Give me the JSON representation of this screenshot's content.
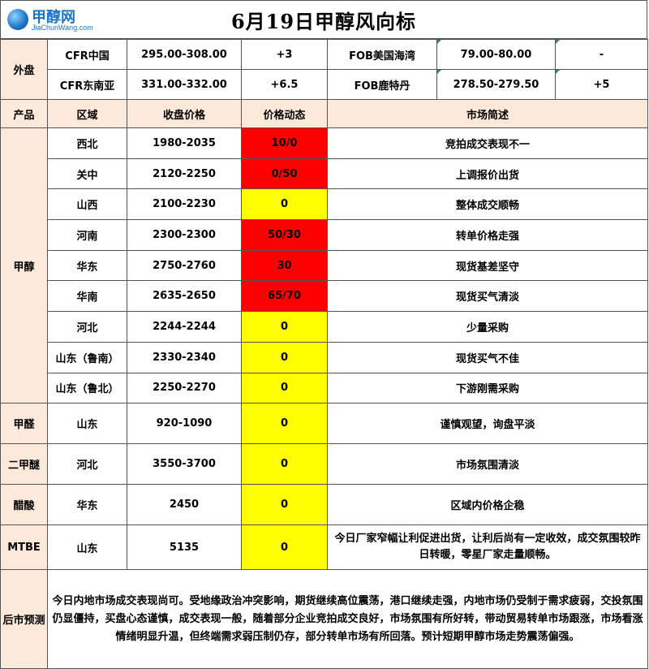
{
  "header": {
    "title": "6月19日甲醇风向标",
    "logo_name": "甲醇网",
    "logo_url": "JiaChunWang.com"
  },
  "external": {
    "label": "外盘",
    "rows": [
      {
        "market_a": "CFR中国",
        "price_a": "295.00-308.00",
        "change_a": "+3",
        "market_b": "FOB美国海湾",
        "price_b": "79.00-80.00",
        "change_b": "-"
      },
      {
        "market_a": "CFR东南亚",
        "price_a": "331.00-332.00",
        "change_a": "+6.5",
        "market_b": "FOB鹿特丹",
        "price_b": "278.50-279.50",
        "change_b": "+5"
      }
    ]
  },
  "columns": {
    "product": "产品",
    "region": "区域",
    "close_price": "收盘价格",
    "price_move": "价格动态",
    "market_brief": "市场简述"
  },
  "products": [
    {
      "name": "甲醇",
      "rows": [
        {
          "region": "西北",
          "price": "1980-2035",
          "move": "10/0",
          "color": "red",
          "note": "竞拍成交表现不一"
        },
        {
          "region": "关中",
          "price": "2120-2250",
          "move": "0/50",
          "color": "red",
          "note": "上调报价出货"
        },
        {
          "region": "山西",
          "price": "2100-2230",
          "move": "0",
          "color": "yellow",
          "note": "整体成交顺畅"
        },
        {
          "region": "河南",
          "price": "2300-2300",
          "move": "50/30",
          "color": "red",
          "note": "转单价格走强"
        },
        {
          "region": "华东",
          "price": "2750-2760",
          "move": "30",
          "color": "red",
          "note": "现货基差坚守"
        },
        {
          "region": "华南",
          "price": "2635-2650",
          "move": "65/70",
          "color": "red",
          "note": "现货买气清淡"
        },
        {
          "region": "河北",
          "price": "2244-2244",
          "move": "0",
          "color": "yellow",
          "note": "少量采购"
        },
        {
          "region": "山东（鲁南）",
          "price": "2330-2340",
          "move": "0",
          "color": "yellow",
          "note": "现货买气不佳"
        },
        {
          "region": "山东（鲁北）",
          "price": "2250-2270",
          "move": "0",
          "color": "yellow",
          "note": "下游刚需采购"
        }
      ]
    },
    {
      "name": "甲醛",
      "rows": [
        {
          "region": "山东",
          "price": "920-1090",
          "move": "0",
          "color": "yellow",
          "note": "谨慎观望，询盘平淡"
        }
      ]
    },
    {
      "name": "二甲醚",
      "rows": [
        {
          "region": "河北",
          "price": "3550-3700",
          "move": "0",
          "color": "yellow",
          "note": "市场氛围清淡"
        }
      ]
    },
    {
      "name": "醋酸",
      "rows": [
        {
          "region": "华东",
          "price": "2450",
          "move": "0",
          "color": "yellow",
          "note": "区域内价格企稳"
        }
      ]
    },
    {
      "name": "MTBE",
      "rows": [
        {
          "region": "山东",
          "price": "5135",
          "move": "0",
          "color": "yellow",
          "note": "今日厂家窄幅让利促进出货，让利后尚有一定收效，成交氛围较昨日转暖，零星厂家走量顺畅。"
        }
      ]
    }
  ],
  "forecast": {
    "label": "后市预测",
    "text": "今日内地市场成交表现尚可。受地缘政治冲突影响，期货继续高位震荡，港口继续走强，内地市场仍受制于需求疲弱，交投氛围仍显僵持，买盘心态谨慎，成交表现一般，随着部分企业竞拍成交良好，市场氛围有所好转，带动贸易转单市场跟涨，市场看涨情绪明显升温，但终端需求弱压制仍存，部分转单市场有所回落。预计短期甲醇市场走势震荡偏强。"
  },
  "colors": {
    "red": "#ff0000",
    "yellow": "#ffff00",
    "label_bg": "#fde9d9",
    "border": "#555555"
  }
}
